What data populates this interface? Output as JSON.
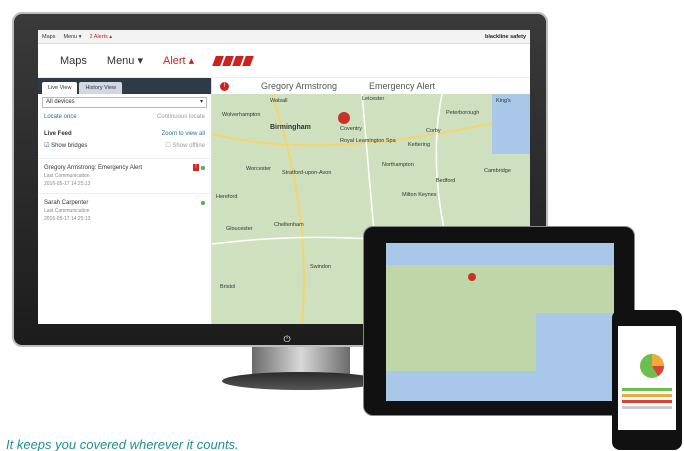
{
  "strip": {
    "maps": "Maps",
    "menu": "Menu ▾",
    "alerts": "2 Alerts ▴",
    "brand": "blackline safety"
  },
  "nav": {
    "maps": "Maps",
    "menu": "Menu ▾",
    "alert": "Alert ▴"
  },
  "tabs": {
    "live": "Live View",
    "history": "History View"
  },
  "devices_select": "All devices",
  "locate_once": "Locate once",
  "continuous": "Continuous locate",
  "live_feed": "Live Feed",
  "zoom_all": "Zoom to view all",
  "show_bridges": "Show bridges",
  "show_offline": "Show offline",
  "entries": [
    {
      "name": "Gregory Armstrong: Emergency Alert",
      "sub1": "Last Communication",
      "sub2": "2016-05-17 14:25:13"
    },
    {
      "name": "Sarah Carpenter",
      "sub1": "Last Communication",
      "sub2": "2016-05-17 14:25:13"
    }
  ],
  "header": {
    "person": "Gregory Armstrong",
    "status": "Emergency Alert"
  },
  "map_labels": [
    "Wolverhampton",
    "Birmingham",
    "Coventry",
    "Royal Leamington Spa",
    "Leicester",
    "Peterborough",
    "Corby",
    "Kettering",
    "Northampton",
    "Bedford",
    "Cambridge",
    "Worcester",
    "Stratford-upon-Avon",
    "Milton Keynes",
    "Gloucester",
    "Cheltenham",
    "Swindon",
    "Bristol",
    "King's",
    "Walsall",
    "Hereford"
  ],
  "caption": "It keeps you covered wherever it counts."
}
